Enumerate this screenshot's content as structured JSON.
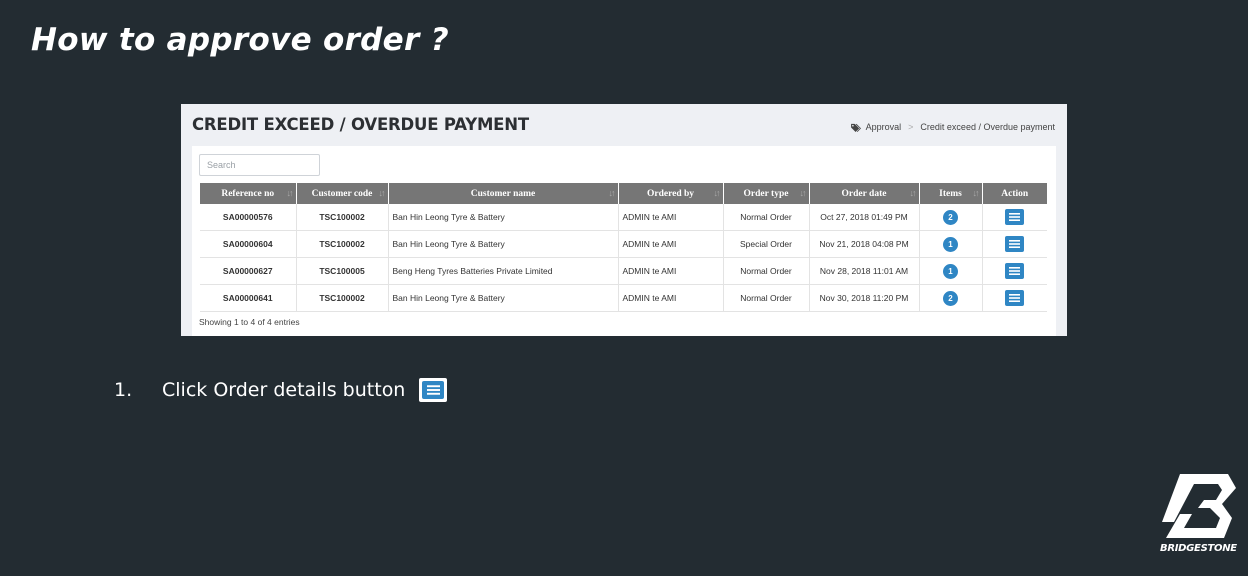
{
  "slide": {
    "title": "How to approve order ?",
    "instruction_number": "1.",
    "instruction_text": "Click Order details button",
    "logo_text": "BRIDGESTONE"
  },
  "screen": {
    "heading": "CREDIT EXCEED / OVERDUE PAYMENT",
    "breadcrumb": [
      "Approval",
      "Credit exceed / Overdue payment"
    ],
    "search": {
      "placeholder": "Search",
      "value": ""
    },
    "columns": [
      "Reference no",
      "Customer code",
      "Customer name",
      "Ordered by",
      "Order type",
      "Order date",
      "Items",
      "Action"
    ],
    "rows": [
      {
        "ref": "SA00000576",
        "code": "TSC100002",
        "name": "Ban Hin Leong Tyre & Battery",
        "by": "ADMIN te AMI",
        "type": "Normal Order",
        "date": "Oct 27, 2018 01:49 PM",
        "items": "2"
      },
      {
        "ref": "SA00000604",
        "code": "TSC100002",
        "name": "Ban Hin Leong Tyre & Battery",
        "by": "ADMIN te AMI",
        "type": "Special Order",
        "date": "Nov 21, 2018 04:08 PM",
        "items": "1"
      },
      {
        "ref": "SA00000627",
        "code": "TSC100005",
        "name": "Beng Heng Tyres Batteries Private Limited",
        "by": "ADMIN te AMI",
        "type": "Normal Order",
        "date": "Nov 28, 2018 11:01 AM",
        "items": "1"
      },
      {
        "ref": "SA00000641",
        "code": "TSC100002",
        "name": "Ban Hin Leong Tyre & Battery",
        "by": "ADMIN te AMI",
        "type": "Normal Order",
        "date": "Nov 30, 2018 11:20 PM",
        "items": "2"
      }
    ],
    "entries_info": "Showing 1 to 4 of 4 entries"
  },
  "colors": {
    "slide_background": "#232c32",
    "header_gray": "#767676",
    "accent_blue": "#2f86c4"
  },
  "icons": {
    "breadcrumb": "tag-icon",
    "sort": "sort-arrows-icon",
    "action": "list-icon",
    "logo": "bridgestone-b-logo"
  }
}
